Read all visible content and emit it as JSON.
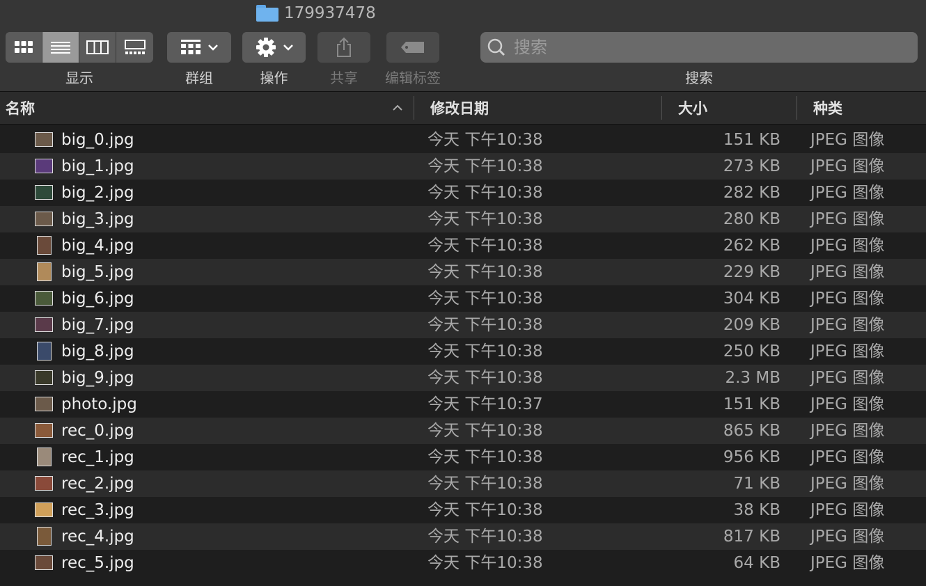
{
  "window": {
    "title": "179937478"
  },
  "toolbar": {
    "view_label": "显示",
    "group_label": "群组",
    "action_label": "操作",
    "share_label": "共享",
    "tag_label": "编辑标签",
    "search_label": "搜索",
    "search_placeholder": "搜索"
  },
  "columns": {
    "name": "名称",
    "date": "修改日期",
    "size": "大小",
    "kind": "种类"
  },
  "files": [
    {
      "name": "big_0.jpg",
      "date": "今天 下午10:38",
      "size": "151 KB",
      "kind": "JPEG 图像",
      "thumb": "#6b5a4a",
      "tall": false
    },
    {
      "name": "big_1.jpg",
      "date": "今天 下午10:38",
      "size": "273 KB",
      "kind": "JPEG 图像",
      "thumb": "#5a3a7a",
      "tall": false
    },
    {
      "name": "big_2.jpg",
      "date": "今天 下午10:38",
      "size": "282 KB",
      "kind": "JPEG 图像",
      "thumb": "#2e4a3a",
      "tall": false
    },
    {
      "name": "big_3.jpg",
      "date": "今天 下午10:38",
      "size": "280 KB",
      "kind": "JPEG 图像",
      "thumb": "#6b5a4a",
      "tall": false
    },
    {
      "name": "big_4.jpg",
      "date": "今天 下午10:38",
      "size": "262 KB",
      "kind": "JPEG 图像",
      "thumb": "#6a4a3a",
      "tall": true
    },
    {
      "name": "big_5.jpg",
      "date": "今天 下午10:38",
      "size": "229 KB",
      "kind": "JPEG 图像",
      "thumb": "#b08a5a",
      "tall": true
    },
    {
      "name": "big_6.jpg",
      "date": "今天 下午10:38",
      "size": "304 KB",
      "kind": "JPEG 图像",
      "thumb": "#4a5a3a",
      "tall": false
    },
    {
      "name": "big_7.jpg",
      "date": "今天 下午10:38",
      "size": "209 KB",
      "kind": "JPEG 图像",
      "thumb": "#5a3a4a",
      "tall": false
    },
    {
      "name": "big_8.jpg",
      "date": "今天 下午10:38",
      "size": "250 KB",
      "kind": "JPEG 图像",
      "thumb": "#3a4a6a",
      "tall": true
    },
    {
      "name": "big_9.jpg",
      "date": "今天 下午10:38",
      "size": "2.3 MB",
      "kind": "JPEG 图像",
      "thumb": "#3a3a2a",
      "tall": false
    },
    {
      "name": "photo.jpg",
      "date": "今天 下午10:37",
      "size": "151 KB",
      "kind": "JPEG 图像",
      "thumb": "#6b5a4a",
      "tall": false
    },
    {
      "name": "rec_0.jpg",
      "date": "今天 下午10:38",
      "size": "865 KB",
      "kind": "JPEG 图像",
      "thumb": "#8a5a3a",
      "tall": false
    },
    {
      "name": "rec_1.jpg",
      "date": "今天 下午10:38",
      "size": "956 KB",
      "kind": "JPEG 图像",
      "thumb": "#9a8a7a",
      "tall": true
    },
    {
      "name": "rec_2.jpg",
      "date": "今天 下午10:38",
      "size": "71 KB",
      "kind": "JPEG 图像",
      "thumb": "#8a4a3a",
      "tall": false
    },
    {
      "name": "rec_3.jpg",
      "date": "今天 下午10:38",
      "size": "38 KB",
      "kind": "JPEG 图像",
      "thumb": "#d0a05a",
      "tall": false
    },
    {
      "name": "rec_4.jpg",
      "date": "今天 下午10:38",
      "size": "817 KB",
      "kind": "JPEG 图像",
      "thumb": "#7a5a3a",
      "tall": true
    },
    {
      "name": "rec_5.jpg",
      "date": "今天 下午10:38",
      "size": "64 KB",
      "kind": "JPEG 图像",
      "thumb": "#6a4a3a",
      "tall": false
    }
  ]
}
